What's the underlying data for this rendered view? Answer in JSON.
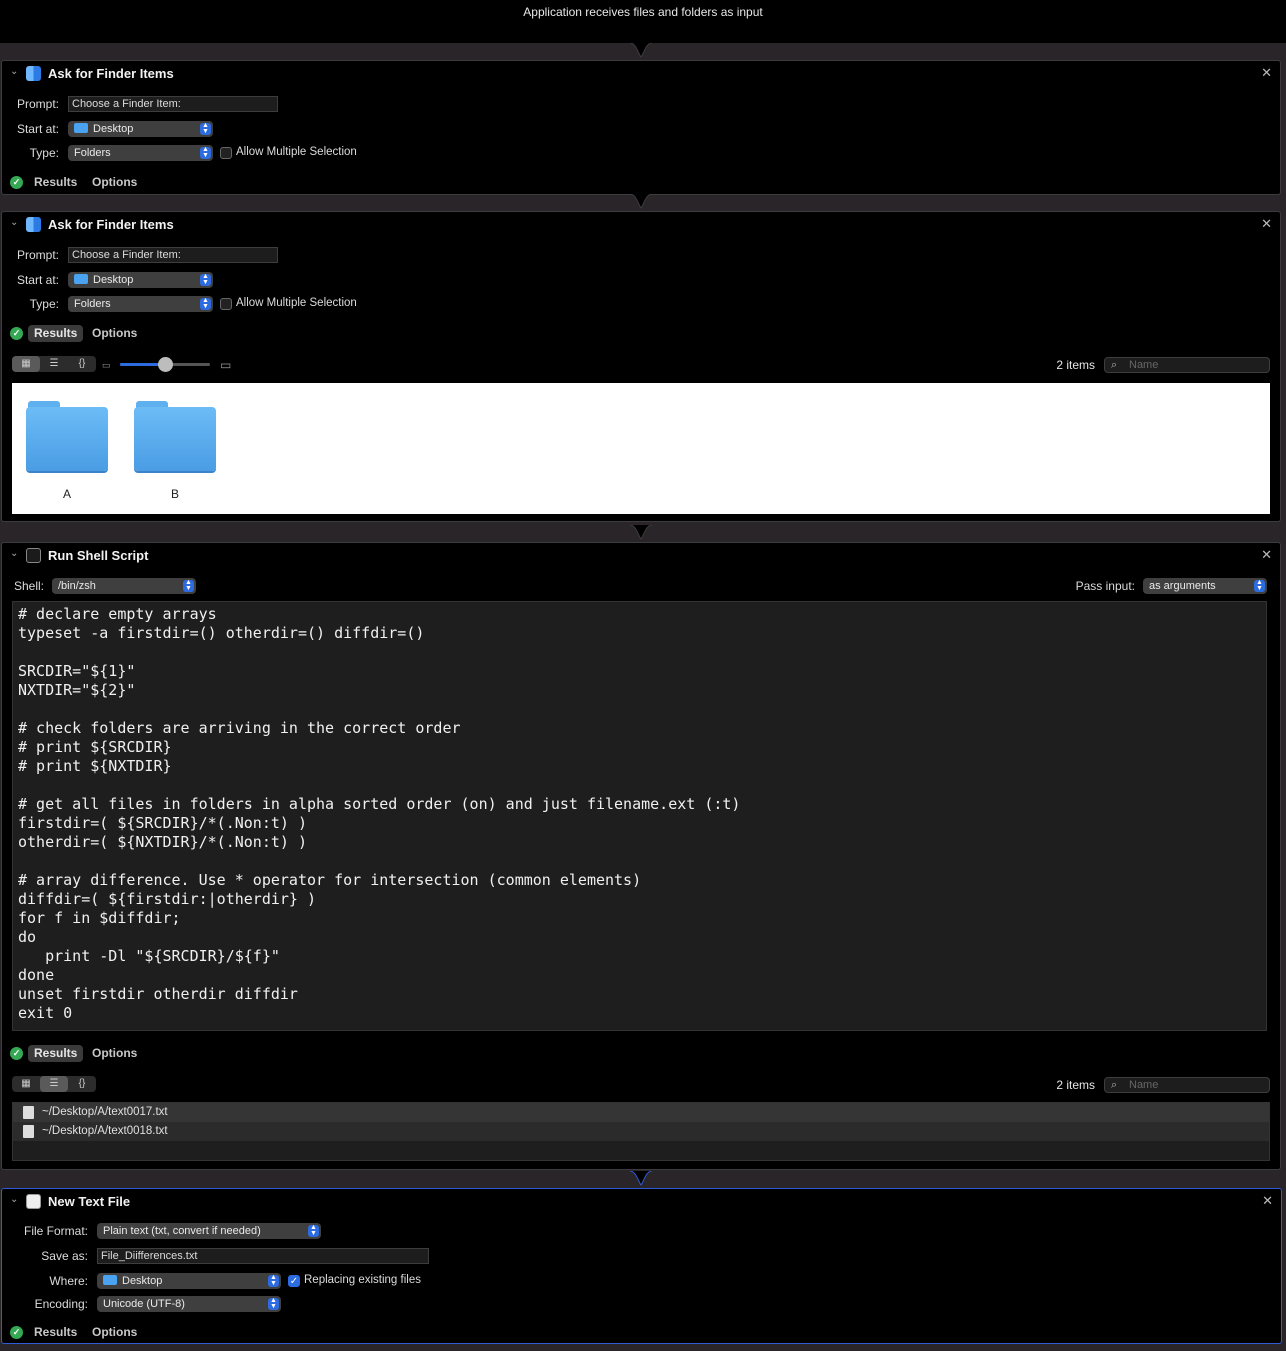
{
  "header": {
    "text": "Application receives files and folders as input"
  },
  "action1": {
    "title": "Ask for Finder Items",
    "prompt_label": "Prompt:",
    "prompt_value": "Choose a Finder Item:",
    "startat_label": "Start at:",
    "startat_value": "Desktop",
    "type_label": "Type:",
    "type_value": "Folders",
    "multi_label": "Allow Multiple Selection",
    "results_tab": "Results",
    "options_tab": "Options"
  },
  "action2": {
    "title": "Ask for Finder Items",
    "prompt_label": "Prompt:",
    "prompt_value": "Choose a Finder Item:",
    "startat_label": "Start at:",
    "startat_value": "Desktop",
    "type_label": "Type:",
    "type_value": "Folders",
    "multi_label": "Allow Multiple Selection",
    "results_tab": "Results",
    "options_tab": "Options",
    "item_count": "2 items",
    "search_placeholder": "Name",
    "icon_size_fraction": 0.5,
    "items": [
      "A",
      "B"
    ]
  },
  "action3": {
    "title": "Run Shell Script",
    "shell_label": "Shell:",
    "shell_value": "/bin/zsh",
    "passinput_label": "Pass input:",
    "passinput_value": "as arguments",
    "code": "# declare empty arrays\ntypeset -a firstdir=() otherdir=() diffdir=()\n\nSRCDIR=\"${1}\"\nNXTDIR=\"${2}\"\n\n# check folders are arriving in the correct order\n# print ${SRCDIR}\n# print ${NXTDIR}\n\n# get all files in folders in alpha sorted order (on) and just filename.ext (:t)\nfirstdir=( ${SRCDIR}/*(.Non:t) )\notherdir=( ${NXTDIR}/*(.Non:t) )\n\n# array difference. Use * operator for intersection (common elements)\ndiffdir=( ${firstdir:|otherdir} )\nfor f in $diffdir;\ndo\n   print -Dl \"${SRCDIR}/${f}\"\ndone\nunset firstdir otherdir diffdir\nexit 0",
    "results_tab": "Results",
    "options_tab": "Options",
    "item_count": "2 items",
    "search_placeholder": "Name",
    "results": [
      "~/Desktop/A/text0017.txt",
      "~/Desktop/A/text0018.txt"
    ]
  },
  "action4": {
    "title": "New Text File",
    "format_label": "File Format:",
    "format_value": "Plain text (txt, convert if needed)",
    "saveas_label": "Save as:",
    "saveas_value": "File_Diifferences.txt",
    "where_label": "Where:",
    "where_value": "Desktop",
    "replace_label": "Replacing existing files",
    "encoding_label": "Encoding:",
    "encoding_value": "Unicode (UTF-8)",
    "results_tab": "Results",
    "options_tab": "Options"
  },
  "icons": {
    "close": "✕",
    "chevron": "⌄",
    "search": "⌕",
    "check": "✓"
  },
  "colors": {
    "accent": "#2d6ce0",
    "success": "#34a853",
    "folder": "#4aa3f0"
  }
}
